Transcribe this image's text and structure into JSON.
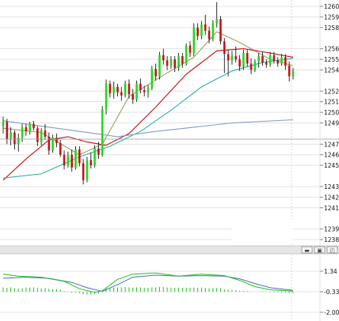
{
  "colors": {
    "bull": "#21d81b",
    "bear": "#c2131c",
    "ma_fast": "#9fa061",
    "ma_mid": "#c40d0d",
    "ma_slow": "#31afae",
    "ma_long": "#7f9ec1",
    "grid": "#e3e3e3",
    "macd_hist": "#22c11f",
    "macd_line": "#1fc31a",
    "signal_line": "#4f6fb9"
  },
  "price_axis": {
    "labels": [
      "1260.",
      "1259.",
      "1258.",
      "1256.",
      "1255.",
      "1254.",
      "1252.",
      "1251.",
      "1250.",
      "1249.",
      "1247.",
      "1246.",
      "1245.",
      "1243.",
      "1242.",
      "1241.",
      "1239.",
      "1238."
    ]
  },
  "current_price_label": "",
  "indicator_axis": {
    "labels": [
      "1.34",
      "-0.33",
      "-2.00"
    ]
  },
  "panel_buttons": [
    {
      "name": "minimize-button",
      "glyph": "▬"
    },
    {
      "name": "maximize-button",
      "glyph": "▣"
    },
    {
      "name": "restore-button",
      "glyph": "◰"
    }
  ],
  "chart_data": [
    {
      "type": "candlestick",
      "title": "",
      "ylim": [
        1237.4,
        1260.8
      ],
      "y_ticks": [
        1260.0,
        1259.0,
        1258.0,
        1256.0,
        1255.0,
        1254.0,
        1252.0,
        1251.0,
        1250.0,
        1249.0,
        1247.0,
        1246.0,
        1245.0,
        1243.0,
        1242.0,
        1241.0,
        1239.0,
        1238.0
      ],
      "grid": true,
      "candles": [
        {
          "o": 1248.7,
          "h": 1249.6,
          "l": 1248.0,
          "c": 1249.1
        },
        {
          "o": 1249.1,
          "h": 1249.4,
          "l": 1247.0,
          "c": 1247.5
        },
        {
          "o": 1247.5,
          "h": 1248.6,
          "l": 1246.9,
          "c": 1248.1
        },
        {
          "o": 1248.1,
          "h": 1248.3,
          "l": 1246.5,
          "c": 1247.0
        },
        {
          "o": 1247.0,
          "h": 1248.0,
          "l": 1246.3,
          "c": 1247.6
        },
        {
          "o": 1247.6,
          "h": 1248.9,
          "l": 1247.2,
          "c": 1248.6
        },
        {
          "o": 1248.6,
          "h": 1248.9,
          "l": 1247.8,
          "c": 1248.2
        },
        {
          "o": 1248.2,
          "h": 1249.1,
          "l": 1247.9,
          "c": 1248.9
        },
        {
          "o": 1248.9,
          "h": 1249.2,
          "l": 1248.3,
          "c": 1248.5
        },
        {
          "o": 1248.5,
          "h": 1248.7,
          "l": 1246.8,
          "c": 1247.2
        },
        {
          "o": 1247.2,
          "h": 1248.5,
          "l": 1246.9,
          "c": 1248.3
        },
        {
          "o": 1248.3,
          "h": 1248.9,
          "l": 1247.4,
          "c": 1247.7
        },
        {
          "o": 1247.7,
          "h": 1248.1,
          "l": 1246.0,
          "c": 1246.4
        },
        {
          "o": 1246.4,
          "h": 1247.9,
          "l": 1246.2,
          "c": 1247.6
        },
        {
          "o": 1247.6,
          "h": 1248.0,
          "l": 1246.7,
          "c": 1247.1
        },
        {
          "o": 1247.1,
          "h": 1247.4,
          "l": 1245.8,
          "c": 1246.0
        },
        {
          "o": 1246.0,
          "h": 1246.4,
          "l": 1244.6,
          "c": 1245.0
        },
        {
          "o": 1245.0,
          "h": 1246.3,
          "l": 1244.8,
          "c": 1246.0
        },
        {
          "o": 1246.0,
          "h": 1246.5,
          "l": 1244.4,
          "c": 1244.8
        },
        {
          "o": 1244.8,
          "h": 1246.8,
          "l": 1244.6,
          "c": 1246.5
        },
        {
          "o": 1246.5,
          "h": 1246.8,
          "l": 1244.9,
          "c": 1245.2
        },
        {
          "o": 1245.2,
          "h": 1245.6,
          "l": 1243.2,
          "c": 1243.6
        },
        {
          "o": 1243.6,
          "h": 1245.8,
          "l": 1243.4,
          "c": 1245.5
        },
        {
          "o": 1245.5,
          "h": 1246.2,
          "l": 1244.7,
          "c": 1245.0
        },
        {
          "o": 1245.0,
          "h": 1246.9,
          "l": 1244.8,
          "c": 1246.6
        },
        {
          "o": 1246.6,
          "h": 1247.2,
          "l": 1245.6,
          "c": 1246.0
        },
        {
          "o": 1246.0,
          "h": 1250.6,
          "l": 1245.8,
          "c": 1250.3
        },
        {
          "o": 1250.3,
          "h": 1253.1,
          "l": 1249.8,
          "c": 1252.7
        },
        {
          "o": 1252.7,
          "h": 1253.0,
          "l": 1251.4,
          "c": 1251.8
        },
        {
          "o": 1251.8,
          "h": 1252.9,
          "l": 1251.3,
          "c": 1252.4
        },
        {
          "o": 1252.4,
          "h": 1252.7,
          "l": 1251.5,
          "c": 1251.9
        },
        {
          "o": 1251.9,
          "h": 1252.4,
          "l": 1251.1,
          "c": 1251.6
        },
        {
          "o": 1251.6,
          "h": 1253.0,
          "l": 1251.4,
          "c": 1252.7
        },
        {
          "o": 1252.7,
          "h": 1253.1,
          "l": 1251.3,
          "c": 1251.7
        },
        {
          "o": 1251.7,
          "h": 1252.2,
          "l": 1250.8,
          "c": 1251.2
        },
        {
          "o": 1251.2,
          "h": 1253.0,
          "l": 1251.0,
          "c": 1252.7
        },
        {
          "o": 1252.7,
          "h": 1253.2,
          "l": 1251.8,
          "c": 1252.1
        },
        {
          "o": 1252.1,
          "h": 1252.5,
          "l": 1251.5,
          "c": 1251.9
        },
        {
          "o": 1251.9,
          "h": 1252.6,
          "l": 1251.4,
          "c": 1252.3
        },
        {
          "o": 1252.3,
          "h": 1254.4,
          "l": 1252.1,
          "c": 1254.1
        },
        {
          "o": 1254.1,
          "h": 1254.6,
          "l": 1253.0,
          "c": 1253.4
        },
        {
          "o": 1253.4,
          "h": 1255.7,
          "l": 1253.1,
          "c": 1255.4
        },
        {
          "o": 1255.4,
          "h": 1256.0,
          "l": 1254.5,
          "c": 1254.9
        },
        {
          "o": 1254.9,
          "h": 1255.3,
          "l": 1254.0,
          "c": 1254.4
        },
        {
          "o": 1254.4,
          "h": 1255.3,
          "l": 1254.1,
          "c": 1255.0
        },
        {
          "o": 1255.0,
          "h": 1255.3,
          "l": 1253.8,
          "c": 1254.2
        },
        {
          "o": 1254.2,
          "h": 1255.6,
          "l": 1253.9,
          "c": 1255.3
        },
        {
          "o": 1255.3,
          "h": 1255.6,
          "l": 1254.2,
          "c": 1254.6
        },
        {
          "o": 1254.6,
          "h": 1256.5,
          "l": 1254.4,
          "c": 1256.3
        },
        {
          "o": 1256.3,
          "h": 1256.7,
          "l": 1255.2,
          "c": 1255.6
        },
        {
          "o": 1255.6,
          "h": 1258.4,
          "l": 1255.3,
          "c": 1258.0
        },
        {
          "o": 1258.0,
          "h": 1258.4,
          "l": 1256.8,
          "c": 1257.2
        },
        {
          "o": 1257.2,
          "h": 1258.6,
          "l": 1256.9,
          "c": 1258.3
        },
        {
          "o": 1258.3,
          "h": 1259.2,
          "l": 1257.3,
          "c": 1257.7
        },
        {
          "o": 1257.7,
          "h": 1258.1,
          "l": 1256.5,
          "c": 1256.9
        },
        {
          "o": 1256.9,
          "h": 1258.7,
          "l": 1256.7,
          "c": 1258.4
        },
        {
          "o": 1258.4,
          "h": 1260.4,
          "l": 1258.0,
          "c": 1258.8
        },
        {
          "o": 1258.8,
          "h": 1259.1,
          "l": 1256.4,
          "c": 1256.7
        },
        {
          "o": 1256.7,
          "h": 1257.0,
          "l": 1253.7,
          "c": 1255.5
        },
        {
          "o": 1255.5,
          "h": 1255.9,
          "l": 1253.4,
          "c": 1254.9
        },
        {
          "o": 1254.9,
          "h": 1255.8,
          "l": 1254.5,
          "c": 1255.3
        },
        {
          "o": 1255.3,
          "h": 1256.2,
          "l": 1254.7,
          "c": 1255.0
        },
        {
          "o": 1255.0,
          "h": 1255.4,
          "l": 1253.9,
          "c": 1254.3
        },
        {
          "o": 1254.3,
          "h": 1255.9,
          "l": 1254.0,
          "c": 1255.6
        },
        {
          "o": 1255.6,
          "h": 1255.9,
          "l": 1254.3,
          "c": 1254.6
        },
        {
          "o": 1254.6,
          "h": 1255.1,
          "l": 1253.6,
          "c": 1254.0
        },
        {
          "o": 1254.0,
          "h": 1255.0,
          "l": 1253.8,
          "c": 1254.8
        },
        {
          "o": 1254.8,
          "h": 1255.6,
          "l": 1254.2,
          "c": 1255.3
        },
        {
          "o": 1255.3,
          "h": 1255.7,
          "l": 1254.4,
          "c": 1254.7
        },
        {
          "o": 1254.7,
          "h": 1255.0,
          "l": 1254.2,
          "c": 1254.5
        },
        {
          "o": 1254.5,
          "h": 1255.7,
          "l": 1254.3,
          "c": 1255.4
        },
        {
          "o": 1255.4,
          "h": 1255.7,
          "l": 1254.6,
          "c": 1254.9
        },
        {
          "o": 1254.9,
          "h": 1255.2,
          "l": 1254.3,
          "c": 1254.6
        },
        {
          "o": 1254.6,
          "h": 1255.5,
          "l": 1254.4,
          "c": 1255.2
        },
        {
          "o": 1255.2,
          "h": 1255.5,
          "l": 1254.0,
          "c": 1254.4
        },
        {
          "o": 1254.4,
          "h": 1254.8,
          "l": 1252.9,
          "c": 1253.4
        },
        {
          "o": 1253.4,
          "h": 1254.2,
          "l": 1253.1,
          "c": 1253.9
        }
      ],
      "moving_averages": [
        {
          "key": "ma_fast",
          "points": [
            [
              0,
              1248.5
            ],
            [
              10,
              1248.1
            ],
            [
              20,
              1246.0
            ],
            [
              26,
              1247.0
            ],
            [
              33,
              1251.5
            ],
            [
              42,
              1253.5
            ],
            [
              50,
              1255.2
            ],
            [
              56,
              1257.6
            ],
            [
              62,
              1256.6
            ],
            [
              70,
              1255.0
            ],
            [
              76,
              1254.4
            ]
          ]
        },
        {
          "key": "ma_mid",
          "points": [
            [
              0,
              1243.6
            ],
            [
              6,
              1245.6
            ],
            [
              12,
              1247.4
            ],
            [
              17,
              1247.7
            ],
            [
              22,
              1247.2
            ],
            [
              27,
              1246.9
            ],
            [
              33,
              1248.0
            ],
            [
              40,
              1250.5
            ],
            [
              48,
              1253.6
            ],
            [
              56,
              1255.8
            ],
            [
              63,
              1256.0
            ],
            [
              70,
              1255.6
            ],
            [
              76,
              1255.2
            ]
          ]
        },
        {
          "key": "ma_slow",
          "points": [
            [
              0,
              1243.8
            ],
            [
              10,
              1244.2
            ],
            [
              20,
              1245.8
            ],
            [
              28,
              1246.8
            ],
            [
              36,
              1248.2
            ],
            [
              44,
              1250.2
            ],
            [
              52,
              1252.4
            ],
            [
              60,
              1253.9
            ],
            [
              68,
              1254.7
            ],
            [
              76,
              1255.1
            ]
          ]
        },
        {
          "key": "ma_long",
          "points": [
            [
              0,
              1249.2
            ],
            [
              20,
              1248.2
            ],
            [
              30,
              1247.7
            ],
            [
              40,
              1248.2
            ],
            [
              50,
              1248.6
            ],
            [
              60,
              1249.0
            ],
            [
              76,
              1249.3
            ]
          ]
        }
      ]
    },
    {
      "type": "histogram+line",
      "title": "",
      "ylim": [
        -2.0,
        2.0
      ],
      "y_ticks": [
        1.34,
        -0.33,
        -2.0
      ],
      "histogram": [
        0.6,
        0.55,
        0.62,
        0.5,
        0.45,
        0.5,
        0.58,
        0.6,
        0.62,
        0.55,
        0.48,
        0.5,
        0.42,
        0.35,
        0.38,
        0.3,
        0.1,
        -0.05,
        -0.15,
        -0.1,
        -0.2,
        -0.35,
        -0.4,
        -0.38,
        -0.3,
        -0.28,
        0.1,
        0.45,
        0.55,
        0.6,
        0.62,
        0.6,
        0.65,
        0.62,
        0.58,
        0.62,
        0.6,
        0.55,
        0.55,
        0.62,
        0.6,
        0.68,
        0.66,
        0.6,
        0.58,
        0.55,
        0.58,
        0.55,
        0.58,
        0.55,
        0.6,
        0.55,
        0.58,
        0.55,
        0.5,
        0.52,
        0.55,
        0.48,
        0.35,
        0.28,
        0.25,
        0.22,
        0.15,
        0.12,
        0.08,
        0.05,
        0.02,
        -0.02,
        -0.05,
        -0.05,
        -0.08,
        -0.1,
        -0.1,
        -0.12,
        -0.15,
        -0.18,
        -0.2
      ],
      "macd": [
        [
          0,
          1.3
        ],
        [
          4,
          1.1
        ],
        [
          10,
          1.0
        ],
        [
          16,
          0.6
        ],
        [
          20,
          -0.1
        ],
        [
          24,
          -0.45
        ],
        [
          26,
          -0.3
        ],
        [
          30,
          0.8
        ],
        [
          34,
          1.3
        ],
        [
          40,
          1.4
        ],
        [
          46,
          1.1
        ],
        [
          52,
          1.3
        ],
        [
          58,
          1.15
        ],
        [
          62,
          0.7
        ],
        [
          66,
          0.1
        ],
        [
          70,
          -0.2
        ],
        [
          76,
          -0.33
        ]
      ],
      "signal": [
        [
          0,
          0.9
        ],
        [
          6,
          1.0
        ],
        [
          12,
          0.9
        ],
        [
          18,
          0.5
        ],
        [
          22,
          0.0
        ],
        [
          26,
          -0.35
        ],
        [
          30,
          0.3
        ],
        [
          34,
          1.0
        ],
        [
          40,
          1.2
        ],
        [
          46,
          1.1
        ],
        [
          52,
          1.15
        ],
        [
          58,
          1.1
        ],
        [
          62,
          0.85
        ],
        [
          66,
          0.4
        ],
        [
          70,
          0.0
        ],
        [
          76,
          -0.25
        ]
      ]
    }
  ]
}
